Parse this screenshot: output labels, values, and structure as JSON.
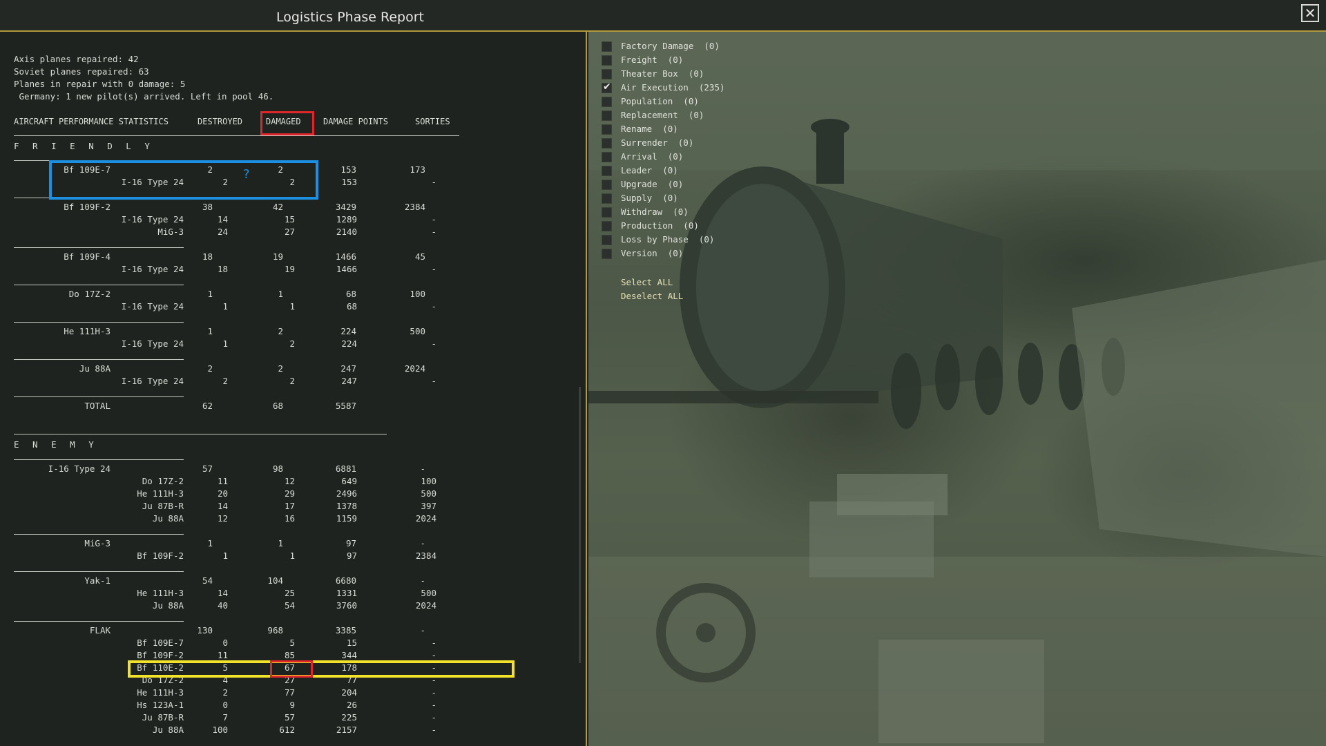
{
  "window": {
    "title": "Logistics Phase Report",
    "close_icon": "close-icon"
  },
  "summary": [
    "Axis planes repaired: 42",
    "Soviet planes repaired: 63",
    "Planes in repair with 0 damage: 5",
    " Germany: 1 new pilot(s) arrived. Left in pool 46."
  ],
  "table": {
    "title": "AIRCRAFT PERFORMANCE STATISTICS",
    "columns": [
      "DESTROYED",
      "DAMAGED",
      "DAMAGE POINTS",
      "SORTIES"
    ],
    "friendly_label": "F R I E N D L Y",
    "enemy_label": "E N E M Y",
    "friendly": [
      {
        "name": "Bf 109E-7",
        "destroyed": "2",
        "damaged": "2",
        "points": "153",
        "sorties": "173",
        "subs": [
          {
            "name": "I-16 Type 24",
            "destroyed": "2",
            "damaged": "2",
            "points": "153",
            "sorties": "-"
          }
        ]
      },
      {
        "name": "Bf 109F-2",
        "destroyed": "38",
        "damaged": "42",
        "points": "3429",
        "sorties": "2384",
        "subs": [
          {
            "name": "I-16 Type 24",
            "destroyed": "14",
            "damaged": "15",
            "points": "1289",
            "sorties": "-"
          },
          {
            "name": "MiG-3",
            "destroyed": "24",
            "damaged": "27",
            "points": "2140",
            "sorties": "-"
          }
        ]
      },
      {
        "name": "Bf 109F-4",
        "destroyed": "18",
        "damaged": "19",
        "points": "1466",
        "sorties": "45",
        "subs": [
          {
            "name": "I-16 Type 24",
            "destroyed": "18",
            "damaged": "19",
            "points": "1466",
            "sorties": "-"
          }
        ]
      },
      {
        "name": "Do 17Z-2",
        "destroyed": "1",
        "damaged": "1",
        "points": "68",
        "sorties": "100",
        "subs": [
          {
            "name": "I-16 Type 24",
            "destroyed": "1",
            "damaged": "1",
            "points": "68",
            "sorties": "-"
          }
        ]
      },
      {
        "name": "He 111H-3",
        "destroyed": "1",
        "damaged": "2",
        "points": "224",
        "sorties": "500",
        "subs": [
          {
            "name": "I-16 Type 24",
            "destroyed": "1",
            "damaged": "2",
            "points": "224",
            "sorties": "-"
          }
        ]
      },
      {
        "name": "Ju 88A",
        "destroyed": "2",
        "damaged": "2",
        "points": "247",
        "sorties": "2024",
        "subs": [
          {
            "name": "I-16 Type 24",
            "destroyed": "2",
            "damaged": "2",
            "points": "247",
            "sorties": "-"
          }
        ]
      }
    ],
    "friendly_total": {
      "name": "TOTAL",
      "destroyed": "62",
      "damaged": "68",
      "points": "5587"
    },
    "enemy": [
      {
        "name": "I-16 Type 24",
        "destroyed": "57",
        "damaged": "98",
        "points": "6881",
        "sorties": "-",
        "subs": [
          {
            "name": "Do 17Z-2",
            "destroyed": "11",
            "damaged": "12",
            "points": "649",
            "sorties": "100"
          },
          {
            "name": "He 111H-3",
            "destroyed": "20",
            "damaged": "29",
            "points": "2496",
            "sorties": "500"
          },
          {
            "name": "Ju 87B-R",
            "destroyed": "14",
            "damaged": "17",
            "points": "1378",
            "sorties": "397"
          },
          {
            "name": "Ju 88A",
            "destroyed": "12",
            "damaged": "16",
            "points": "1159",
            "sorties": "2024"
          }
        ]
      },
      {
        "name": "MiG-3",
        "destroyed": "1",
        "damaged": "1",
        "points": "97",
        "sorties": "-",
        "subs": [
          {
            "name": "Bf 109F-2",
            "destroyed": "1",
            "damaged": "1",
            "points": "97",
            "sorties": "2384"
          }
        ]
      },
      {
        "name": "Yak-1",
        "destroyed": "54",
        "damaged": "104",
        "points": "6680",
        "sorties": "-",
        "subs": [
          {
            "name": "He 111H-3",
            "destroyed": "14",
            "damaged": "25",
            "points": "1331",
            "sorties": "500"
          },
          {
            "name": "Ju 88A",
            "destroyed": "40",
            "damaged": "54",
            "points": "3760",
            "sorties": "2024"
          }
        ]
      },
      {
        "name": "FLAK",
        "destroyed": "130",
        "damaged": "968",
        "points": "3385",
        "sorties": "-",
        "subs": [
          {
            "name": "Bf 109E-7",
            "destroyed": "0",
            "damaged": "5",
            "points": "15",
            "sorties": "-"
          },
          {
            "name": "Bf 109F-2",
            "destroyed": "11",
            "damaged": "85",
            "points": "344",
            "sorties": "-"
          },
          {
            "name": "Bf 110E-2",
            "destroyed": "5",
            "damaged": "67",
            "points": "178",
            "sorties": "-"
          },
          {
            "name": "Do 17Z-2",
            "destroyed": "4",
            "damaged": "27",
            "points": "77",
            "sorties": "-"
          },
          {
            "name": "He 111H-3",
            "destroyed": "2",
            "damaged": "77",
            "points": "204",
            "sorties": "-"
          },
          {
            "name": "Hs 123A-1",
            "destroyed": "0",
            "damaged": "9",
            "points": "26",
            "sorties": "-"
          },
          {
            "name": "Ju 87B-R",
            "destroyed": "7",
            "damaged": "57",
            "points": "225",
            "sorties": "-"
          },
          {
            "name": "Ju 88A",
            "destroyed": "100",
            "damaged": "612",
            "points": "2157",
            "sorties": "-"
          }
        ]
      }
    ]
  },
  "annotation": {
    "question_mark": "?"
  },
  "colors": {
    "highlight_red": "#e0262a",
    "highlight_blue": "#1c8fe0",
    "highlight_yellow": "#f2e32a",
    "border_gold": "#b39a3c"
  },
  "filters": [
    {
      "label": "Factory Damage  (0)",
      "checked": false
    },
    {
      "label": "Freight  (0)",
      "checked": false
    },
    {
      "label": "Theater Box  (0)",
      "checked": false
    },
    {
      "label": "Air Execution  (235)",
      "checked": true
    },
    {
      "label": "Population  (0)",
      "checked": false
    },
    {
      "label": "Replacement  (0)",
      "checked": false
    },
    {
      "label": "Rename  (0)",
      "checked": false
    },
    {
      "label": "Surrender  (0)",
      "checked": false
    },
    {
      "label": "Arrival  (0)",
      "checked": false
    },
    {
      "label": "Leader  (0)",
      "checked": false
    },
    {
      "label": "Upgrade  (0)",
      "checked": false
    },
    {
      "label": "Supply  (0)",
      "checked": false
    },
    {
      "label": "Withdraw  (0)",
      "checked": false
    },
    {
      "label": "Production  (0)",
      "checked": false
    },
    {
      "label": "Loss by Phase  (0)",
      "checked": false
    },
    {
      "label": "Version  (0)",
      "checked": false
    }
  ],
  "select_all": "Select ALL",
  "deselect_all": "Deselect ALL"
}
